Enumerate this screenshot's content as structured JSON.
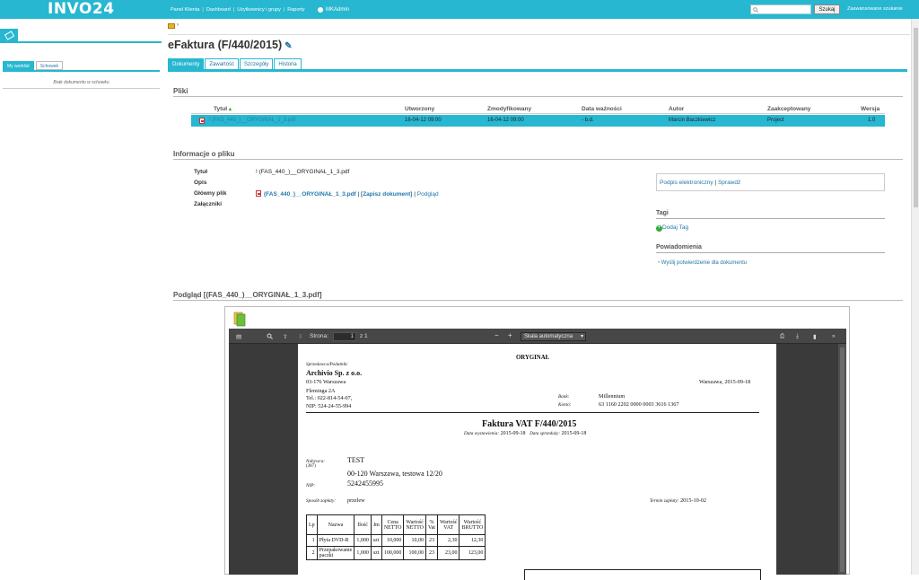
{
  "app": {
    "logo": "INVO24"
  },
  "topnav": {
    "items": [
      "Panel Klienta",
      "Dashboard",
      "Użytkownicy i grupy",
      "Raporty"
    ],
    "user": "MKAdmin",
    "search_placeholder": "",
    "search_button": "Szukaj",
    "advanced_search": "Zaawansowane szukanie"
  },
  "sidebar": {
    "tabs": [
      "My worklist",
      "Schowek"
    ],
    "active_tab": "My worklist",
    "empty_text": "Brak dokumentu w schowku"
  },
  "page": {
    "title": "eFaktura (F/440/2015)",
    "tabs": [
      "Dokumenty",
      "Zawartość",
      "Szczegóły",
      "Historia"
    ],
    "active_tab": "Dokumenty"
  },
  "files": {
    "section_title": "Pliki",
    "columns": {
      "title": "Tytuł",
      "created": "Utworzony",
      "modified": "Zmodyfikowany",
      "expiry": "Data ważności",
      "author": "Autor",
      "accepted": "Zaakceptowany",
      "version": "Wersja"
    },
    "rows": [
      {
        "title": "! (FAS_440_)__ORYGINAŁ_1_3.pdf",
        "created": "16-04-12 09:00",
        "modified": "16-04-12 09:00",
        "expiry": "- b.d.",
        "author": "Marcin Baczkiewicz",
        "accepted": "Project",
        "version": "1.0"
      }
    ]
  },
  "file_info": {
    "section_title": "Informacje o pliku",
    "labels": {
      "title": "Tytuł",
      "description": "Opis",
      "main_file": "Główny plik",
      "attachments": "Załączniki"
    },
    "title_value": "! (FAS_440_)__ORYGINAŁ_1_3.pdf",
    "description_value": "",
    "main_file_link": "(FAS_440_)__ORYGINAŁ_1_3.pdf",
    "save_link": "[Zapisz dokument]",
    "preview_link": "Podgląd"
  },
  "signature": {
    "label": "Podpis elektroniczny",
    "separator": "|",
    "check_link": "Sprawdź"
  },
  "tags": {
    "title": "Tagi",
    "add_label": "Dodaj Tag"
  },
  "notifications": {
    "title": "Powiadomienia",
    "item": "Wyślij potwierdzenie dla dokumentu"
  },
  "preview": {
    "title": "Podgląd [(FAS_440_)__ORYGINAŁ_1_3.pdf]",
    "viewer": {
      "page_label": "Strona:",
      "page_value": "1",
      "page_total": "z 1",
      "zoom": "Skala automatyczna"
    },
    "invoice": {
      "header": "ORYGINAŁ",
      "seller_label": "Sprzedawca/Podatnik:",
      "seller_name": "Archivio Sp. z o.o.",
      "seller_addr1": "03-176 Warszawa",
      "seller_addr2": "Fleminga 2A",
      "seller_tel": "Tel.: 022-814-54-07,",
      "seller_nip": "NIP: 524-24-55-994",
      "place_date": "Warszawa, 2015-09-18",
      "bank_label": "Bank:",
      "bank_value": "Millennium",
      "account_label": "Konto:",
      "account_value": "63 1160 2202 0000 0003 3616 1367",
      "doc_title": "Faktura VAT F/440/2015",
      "issue_label": "Data wystawienia:",
      "issue_date": "2015-09-18",
      "sale_label": "Data sprzedaży:",
      "sale_date": "2015-09-18",
      "buyer_label": "Nabywca:",
      "buyer_code": "(387)",
      "buyer_name": "TEST",
      "buyer_addr": "00-120 Warszawa, testowa 12/20",
      "buyer_nip_label": "NIP:",
      "buyer_nip": "5242455995",
      "payment_label": "Sposób zapłaty:",
      "payment_value": "przelew",
      "due_label": "Termin zapłaty:",
      "due_date": "2015-10-02",
      "table_headers": [
        "Lp",
        "Nazwa",
        "Ilość",
        "Jm",
        "Cena NETTO",
        "Wartość NETTO",
        "% Vat",
        "Wartość VAT",
        "Wartość BRUTTO"
      ],
      "items": [
        [
          "1",
          "Płyta DVD-R",
          "1,000",
          "szt",
          "10,000",
          "10,00",
          "23",
          "2,30",
          "12,30"
        ],
        [
          "2",
          "Przepakowanie paczki",
          "1,000",
          "szt",
          "100,000",
          "100,00",
          "23",
          "23,00",
          "123,00"
        ]
      ]
    }
  },
  "colors": {
    "accent": "#27b7d0",
    "link": "#2277aa"
  }
}
